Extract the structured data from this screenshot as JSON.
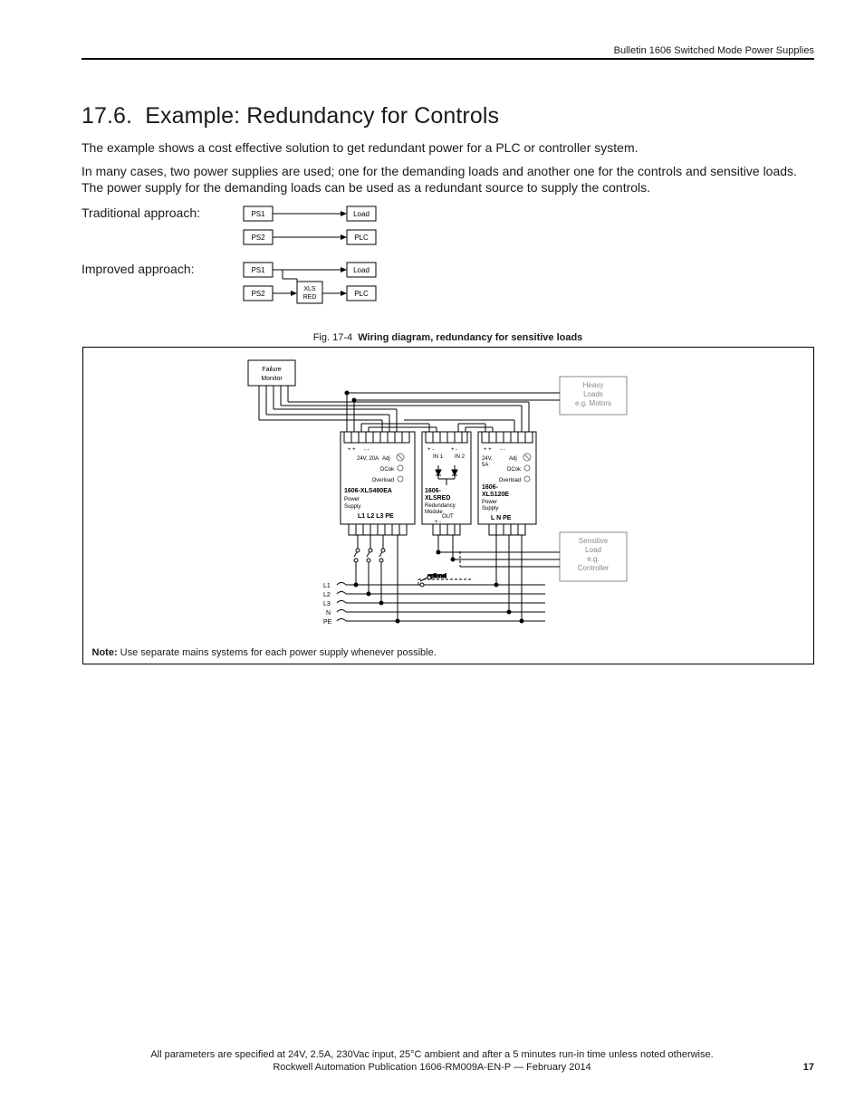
{
  "header": {
    "bulletin": "Bulletin 1606 Switched Mode Power Supplies"
  },
  "section": {
    "number": "17.6.",
    "title": "Example: Redundancy for Controls",
    "p1": "The example shows a cost effective solution to get redundant power for a PLC or controller system.",
    "p2": "In many cases, two power supplies are used; one for the demanding loads and another one for the controls and sensitive loads. The power supply for the demanding loads can be used as a redundant source to supply the controls."
  },
  "traditional": {
    "label": "Traditional approach:",
    "ps1": "PS1",
    "ps2": "PS2",
    "load": "Load",
    "plc": "PLC"
  },
  "improved": {
    "label": "Improved approach:",
    "ps1": "PS1",
    "ps2": "PS2",
    "xlsred": "XLS RED",
    "load": "Load",
    "plc": "PLC"
  },
  "figure": {
    "leader": "Fig. 17-4",
    "caption": "Wiring diagram, redundancy for sensitive loads",
    "failure_monitor": "Failure Monitor",
    "heavy_loads_l1": "Heavy",
    "heavy_loads_l2": "Loads",
    "heavy_loads_l3": "e.g. Motors",
    "sensitive_l1": "Sensitive",
    "sensitive_l2": "Load",
    "sensitive_l3": "e.g.",
    "sensitive_l4": "Controller",
    "ps480_rating": "24V, 20A",
    "adj": "Adj",
    "dcok": "DCok",
    "overload": "Overload",
    "ps480_name": "1606-XLS480EA",
    "ps_line2": "Power",
    "ps_line3": "Supply",
    "l1l2l3pe": "L1 L2 L3 PE",
    "xlsred_name": "1606-XLSRED",
    "xlsred_l2": "Redundancy",
    "xlsred_l3": "Module",
    "in1": "IN 1",
    "in2": "IN 2",
    "out": "OUT",
    "ps120_rating": "24V, 5A",
    "ps120_name": "1606-XLS120E",
    "lnpe": "L   N  PE",
    "optional": "optional",
    "l1": "L1",
    "l2": "L2",
    "l3": "L3",
    "n": "N",
    "pe": "PE",
    "note_bold": "Note:",
    "note_text": " Use separate mains systems for each power supply whenever possible."
  },
  "footer": {
    "line1": "All parameters are specified at 24V, 2.5A, 230Vac input, 25°C ambient and after a 5 minutes run-in time unless noted otherwise.",
    "line2": "Rockwell Automation Publication 1606-RM009A-EN-P — February 2014",
    "page": "17"
  }
}
